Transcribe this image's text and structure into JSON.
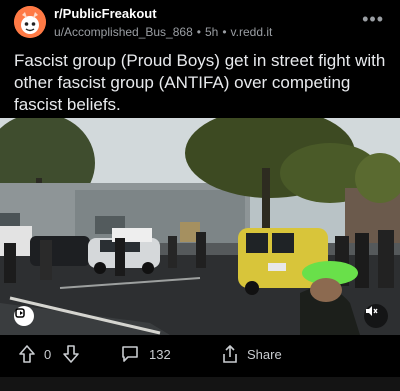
{
  "post": {
    "subreddit": "r/PublicFreakout",
    "author": "u/Accomplished_Bus_868",
    "age": "5h",
    "domain": "v.redd.it",
    "title": "Fascist group (Proud Boys) get in street fight with other fascist group (ANTIFA) over competing fascist beliefs.",
    "more_icon": "more-options-icon"
  },
  "video": {
    "controls": {
      "left_icon": "reddit-video-icon",
      "right_icon": "mute-icon"
    }
  },
  "actions": {
    "vote_count": "0",
    "comment_count": "132",
    "share_label": "Share"
  },
  "colors": {
    "background": "#000000",
    "text": "#d7dadc",
    "muted": "#9a9ea3",
    "avatar": "#ff7a45"
  }
}
